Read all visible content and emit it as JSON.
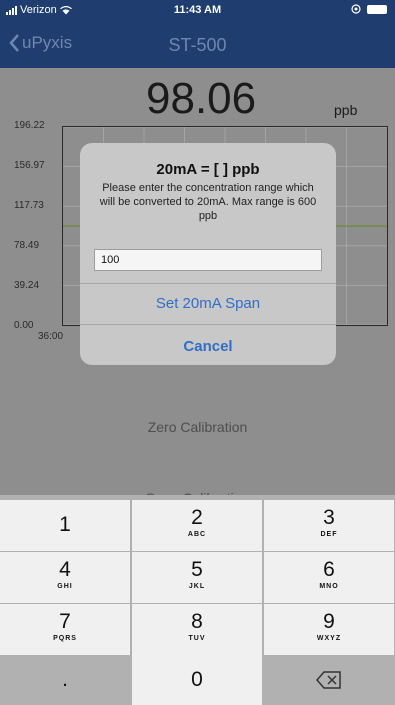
{
  "status_bar": {
    "carrier": "Verizon",
    "time": "11:43 AM"
  },
  "nav": {
    "back_label": "uPyxis",
    "title": "ST-500"
  },
  "reading": {
    "value": "98.06",
    "unit": "ppb"
  },
  "chart_data": {
    "type": "line",
    "title": "",
    "xlabel": "",
    "ylabel": "",
    "y_tick_labels": [
      "196.22",
      "156.97",
      "117.73",
      "78.49",
      "39.24",
      "0.00"
    ],
    "x_tick_labels": [
      "36:00"
    ],
    "ylim": [
      0,
      196.22
    ],
    "series": [
      {
        "values": [
          98.06
        ]
      }
    ],
    "grid": true,
    "colors": {
      "series": "#6f8a3a",
      "grid": "#a9a9a9",
      "axis": "#2a2a2a"
    }
  },
  "dialog": {
    "title": "20mA = [   ] ppb",
    "message": "Please enter the concentration range which will be converted to 20mA. Max range is 600 ppb",
    "input_value": "100",
    "primary_button": "Set 20mA Span",
    "cancel_button": "Cancel"
  },
  "background_labels": {
    "zero_calibration": "Zero Calibration",
    "span_calibration": "Span Calibration"
  },
  "keypad": {
    "keys": [
      {
        "num": "1",
        "letters": ""
      },
      {
        "num": "2",
        "letters": "ABC"
      },
      {
        "num": "3",
        "letters": "DEF"
      },
      {
        "num": "4",
        "letters": "GHI"
      },
      {
        "num": "5",
        "letters": "JKL"
      },
      {
        "num": "6",
        "letters": "MNO"
      },
      {
        "num": "7",
        "letters": "PQRS"
      },
      {
        "num": "8",
        "letters": "TUV"
      },
      {
        "num": "9",
        "letters": "WXYZ"
      },
      {
        "num": ".",
        "letters": ""
      },
      {
        "num": "0",
        "letters": ""
      }
    ],
    "delete_icon": "delete-backspace-icon"
  },
  "colors": {
    "nav_bg": "#1f3d6e",
    "accent": "#2f6fc8",
    "series_line": "#6f8a3a"
  }
}
